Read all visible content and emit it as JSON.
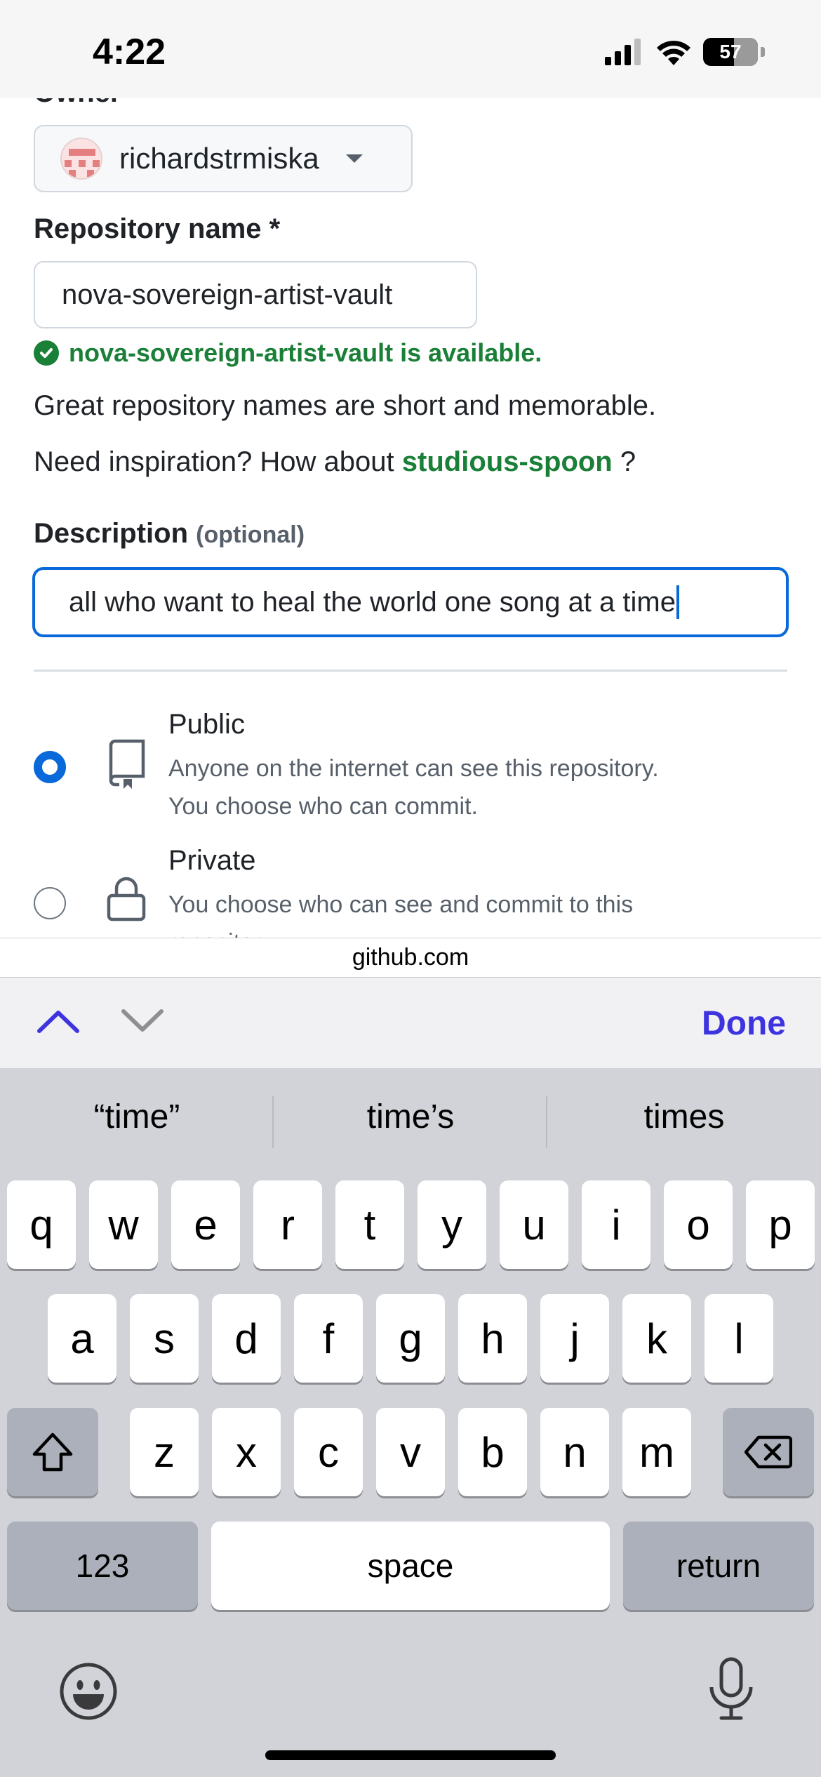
{
  "status_bar": {
    "time": "4:22",
    "battery": "57"
  },
  "form": {
    "owner_label": "Owner",
    "owner_name": "richardstrmiska",
    "repo_label": "Repository name *",
    "repo_value": "nova-sovereign-artist-vault",
    "availability": "nova-sovereign-artist-vault is available.",
    "hint_memorable": "Great repository names are short and memorable.",
    "hint_inspiration": "Need inspiration? How about",
    "suggestion": "studious-spoon",
    "suggestion_suffix": "?",
    "description_label": "Description",
    "description_optional": "(optional)",
    "description_value": "all who want to heal the world one song at a time",
    "visibility": [
      {
        "title": "Public",
        "desc1": "Anyone on the internet can see this repository.",
        "desc2": "You choose who can commit.",
        "selected": true,
        "icon": "repo-icon"
      },
      {
        "title": "Private",
        "desc1": "You choose who can see and commit to this",
        "desc2": "repository.",
        "selected": false,
        "icon": "lock-icon"
      }
    ]
  },
  "browser": {
    "url": "github.com"
  },
  "accessory": {
    "done_label": "Done"
  },
  "keyboard": {
    "predictions": [
      "“time”",
      "time’s",
      "times"
    ],
    "row1": [
      "q",
      "w",
      "e",
      "r",
      "t",
      "y",
      "u",
      "i",
      "o",
      "p"
    ],
    "row2": [
      "a",
      "s",
      "d",
      "f",
      "g",
      "h",
      "j",
      "k",
      "l"
    ],
    "row3": [
      "z",
      "x",
      "c",
      "v",
      "b",
      "n",
      "m"
    ],
    "numbers_label": "123",
    "space_label": "space",
    "return_label": "return"
  },
  "colors": {
    "accent": "#0969da",
    "success": "#1a7f37",
    "done": "#3d34e0"
  }
}
